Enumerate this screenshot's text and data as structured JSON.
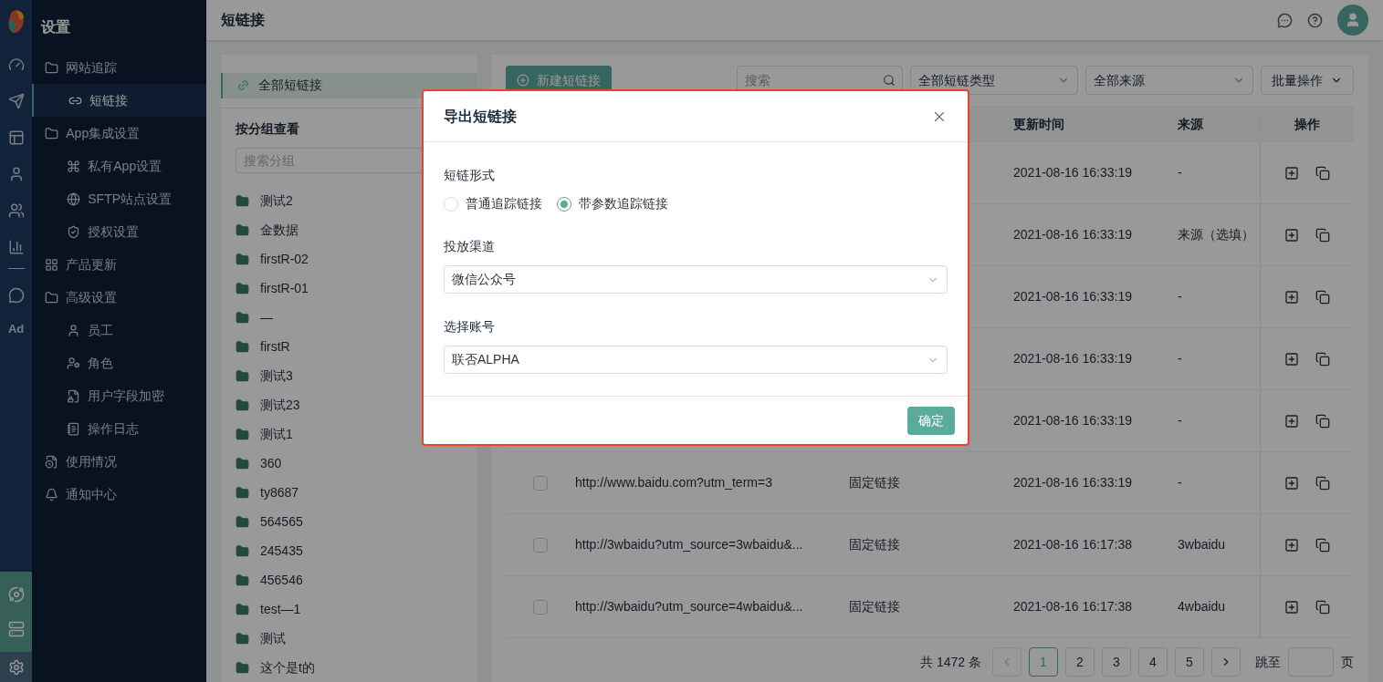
{
  "rail": {
    "badge": "Ad"
  },
  "sidebar": {
    "title": "设置",
    "items": [
      {
        "label": "网站追踪",
        "selected": false,
        "children": [
          {
            "label": "短链接",
            "selected": true
          }
        ]
      },
      {
        "label": "App集成设置",
        "selected": false,
        "children": [
          {
            "label": "私有App设置",
            "selected": false
          },
          {
            "label": "SFTP站点设置",
            "selected": false
          },
          {
            "label": "授权设置",
            "selected": false
          }
        ]
      },
      {
        "label": "产品更新",
        "selected": false
      },
      {
        "label": "高级设置",
        "selected": false,
        "children": [
          {
            "label": "员工",
            "selected": false
          },
          {
            "label": "角色",
            "selected": false
          },
          {
            "label": "用户字段加密",
            "selected": false
          },
          {
            "label": "操作日志",
            "selected": false
          }
        ]
      },
      {
        "label": "使用情况",
        "selected": false
      },
      {
        "label": "通知中心",
        "selected": false
      }
    ]
  },
  "topbar": {
    "title": "短链接"
  },
  "groups_panel": {
    "all_links": {
      "label": "全部短链接",
      "selected": true
    },
    "heading": "按分组查看",
    "search": {
      "placeholder": "搜索分组"
    },
    "groups": [
      "测试2",
      "金数据",
      "firstR-02",
      "firstR-01",
      "—",
      "firstR",
      "测试3",
      "测试23",
      "测试1",
      "360",
      "ty8687",
      "564565",
      "245435",
      "456546",
      "test—1",
      "测试",
      "这个是t的"
    ]
  },
  "toolbar": {
    "new_button": "新建短链接",
    "search": {
      "placeholder": "搜索"
    },
    "type_select": "全部短链类型",
    "source_select": "全部来源",
    "batch_button": "批量操作"
  },
  "table": {
    "columns": [
      "更新时间",
      "来源",
      "操作"
    ],
    "rows": [
      {
        "updated": "2021-08-16 16:33:19",
        "source": "-"
      },
      {
        "updated": "2021-08-16 16:33:19",
        "source": "来源（选填）"
      },
      {
        "updated": "2021-08-16 16:33:19",
        "source": "-"
      },
      {
        "updated": "2021-08-16 16:33:19",
        "source": "-"
      },
      {
        "updated": "2021-08-16 16:33:19",
        "source": "-"
      },
      {
        "checked": false,
        "link": "http://www.baidu.com?utm_term=3",
        "type": "固定链接",
        "updated": "2021-08-16 16:33:19",
        "source": "-"
      },
      {
        "checked": false,
        "link": "http://3wbaidu?utm_source=3wbaidu&...",
        "type": "固定链接",
        "updated": "2021-08-16 16:17:38",
        "source": "3wbaidu"
      },
      {
        "checked": false,
        "link": "http://3wbaidu?utm_source=4wbaidu&...",
        "type": "固定链接",
        "updated": "2021-08-16 16:17:38",
        "source": "4wbaidu"
      }
    ]
  },
  "pagination": {
    "total": "共 1472 条",
    "prev": {
      "disabled": true
    },
    "pages": [
      {
        "label": "1",
        "selected": true
      },
      {
        "label": "2",
        "selected": false
      },
      {
        "label": "3",
        "selected": false
      },
      {
        "label": "4",
        "selected": false
      },
      {
        "label": "5",
        "selected": false
      }
    ],
    "next": {
      "disabled": false
    },
    "jump_label": "跳至",
    "jump_suffix": "页"
  },
  "modal": {
    "title": "导出短链接",
    "form_label": "短链形式",
    "radios": [
      {
        "label": "普通追踪链接",
        "selected": false
      },
      {
        "label": "带参数追踪链接",
        "selected": true
      }
    ],
    "channel": {
      "label": "投放渠道",
      "value": "微信公众号"
    },
    "account": {
      "label": "选择账号",
      "value": "联否ALPHA"
    },
    "confirm": "确定"
  }
}
